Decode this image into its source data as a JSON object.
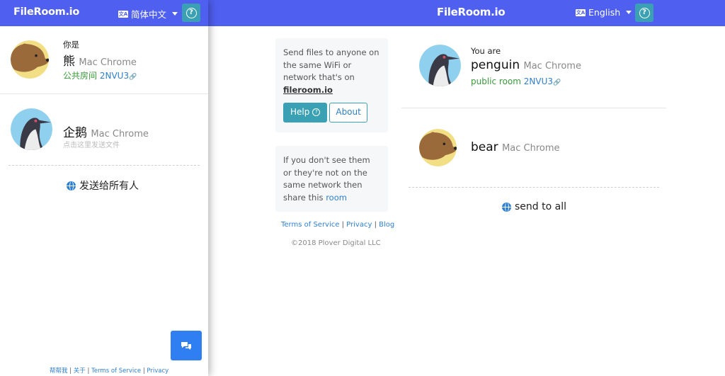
{
  "desktop": {
    "logo": "FileRoom.io",
    "language": "English",
    "help_symbol": "?",
    "info_card": {
      "line1": "Send files to anyone on the same WiFi or network that's on",
      "site": "fileroom.io",
      "help_label": "Help",
      "about_label": "About"
    },
    "share_card": {
      "text": "If you don't see them or they're not on the same network then share this",
      "link": "room"
    },
    "footer": {
      "terms": "Terms of Service",
      "privacy": "Privacy",
      "blog": "Blog",
      "sep": "|",
      "copyright": "©2018 Plover Digital LLC"
    },
    "me": {
      "you_are": "You are",
      "name": "penguin",
      "device": "Mac Chrome",
      "room_prefix": "public room",
      "room_code": "2NVU3"
    },
    "peer": {
      "name": "bear",
      "device": "Mac Chrome"
    },
    "send_all": "send to all"
  },
  "mobile": {
    "logo": "FileRoom.io",
    "language": "简体中文",
    "me": {
      "you_are": "你是",
      "name": "熊",
      "device": "Mac Chrome",
      "room_prefix": "公共房间",
      "room_code": "2NVU3"
    },
    "peer": {
      "name": "企鹅",
      "device": "Mac Chrome",
      "hint": "点击这里发送文件"
    },
    "send_all": "发送给所有人",
    "footer": {
      "help": "帮帮我",
      "about": "关于",
      "terms": "Terms of Service",
      "privacy": "Privacy",
      "sep": "|"
    }
  },
  "colors": {
    "header": "#4f5ff0",
    "help_button": "#3aa1b5",
    "link": "#2f7fd0",
    "room_green": "#3a9a3a",
    "fab": "#2f7ef2"
  },
  "icons": [
    "language-icon",
    "caret-down-icon",
    "help-icon",
    "link-icon",
    "globe-icon",
    "chat-icon",
    "bear-avatar",
    "penguin-avatar"
  ]
}
